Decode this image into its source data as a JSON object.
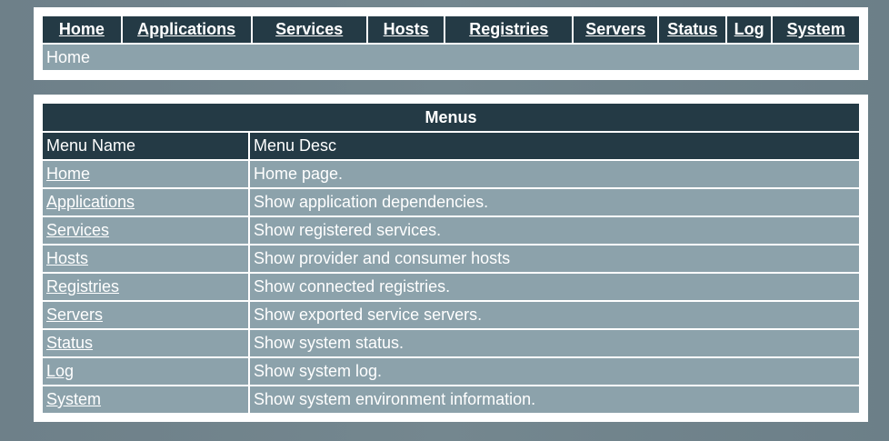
{
  "nav": {
    "items": [
      {
        "label": "Home"
      },
      {
        "label": "Applications"
      },
      {
        "label": "Services"
      },
      {
        "label": "Hosts"
      },
      {
        "label": "Registries"
      },
      {
        "label": "Servers"
      },
      {
        "label": "Status"
      },
      {
        "label": "Log"
      },
      {
        "label": "System"
      }
    ],
    "breadcrumb": "Home"
  },
  "menus": {
    "title": "Menus",
    "columns": [
      "Menu Name",
      "Menu Desc"
    ],
    "rows": [
      {
        "name": "Home",
        "desc": "Home page."
      },
      {
        "name": "Applications",
        "desc": "Show application dependencies."
      },
      {
        "name": "Services",
        "desc": "Show registered services."
      },
      {
        "name": "Hosts",
        "desc": "Show provider and consumer hosts"
      },
      {
        "name": "Registries",
        "desc": "Show connected registries."
      },
      {
        "name": "Servers",
        "desc": "Show exported service servers."
      },
      {
        "name": "Status",
        "desc": "Show system status."
      },
      {
        "name": "Log",
        "desc": "Show system log."
      },
      {
        "name": "System",
        "desc": "Show system environment information."
      }
    ]
  },
  "colors": {
    "dark_row": "#243a45",
    "light_row": "#8ca2ab",
    "page_background": "#6e8089"
  }
}
